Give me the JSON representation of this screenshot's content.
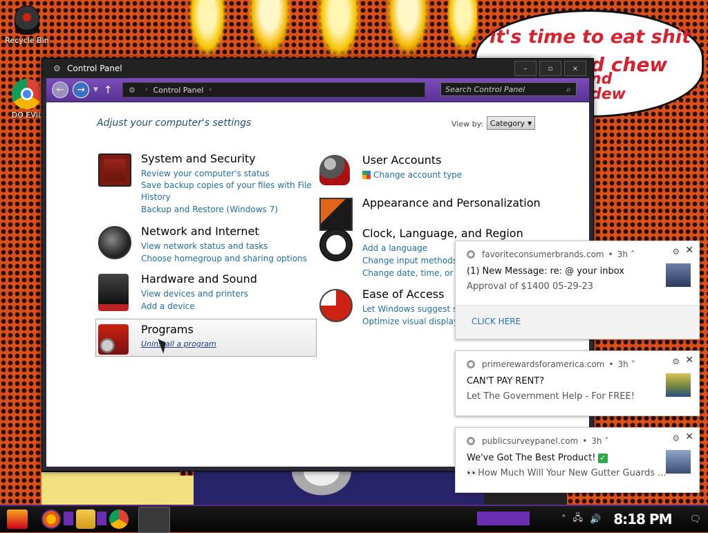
{
  "desktop": {
    "icons": [
      {
        "label": "Recycle Bin",
        "icon": "recycle-bin-icon"
      },
      {
        "label": "DO EVIL",
        "icon": "chrome-icon"
      }
    ],
    "wallpaper_text": [
      "it's time to eat shit",
      "d chew",
      "nd",
      "dew"
    ]
  },
  "window": {
    "title": "Control Panel",
    "buttons": {
      "minimize": "–",
      "maximize": "▫",
      "close": "×"
    },
    "address": {
      "crumb": "Control Panel"
    },
    "search": {
      "placeholder": "Search Control Panel"
    },
    "heading": "Adjust your computer's settings",
    "view_by": {
      "label": "View by:",
      "value": "Category"
    },
    "categories": [
      {
        "title": "System and Security",
        "icon": "system-security-icon",
        "links": [
          "Review your computer's status",
          "Save backup copies of your files with File History",
          "Backup and Restore (Windows 7)"
        ]
      },
      {
        "title": "Network and Internet",
        "icon": "network-icon",
        "links": [
          "View network status and tasks",
          "Choose homegroup and sharing options"
        ]
      },
      {
        "title": "Hardware and Sound",
        "icon": "hardware-icon",
        "links": [
          "View devices and printers",
          "Add a device"
        ]
      },
      {
        "title": "Programs",
        "icon": "programs-icon",
        "links": [
          "Uninstall a program"
        ]
      },
      {
        "title": "User Accounts",
        "icon": "user-accounts-icon",
        "links": [
          "Change account type"
        ]
      },
      {
        "title": "Appearance and Personalization",
        "icon": "appearance-icon",
        "links": []
      },
      {
        "title": "Clock, Language, and Region",
        "icon": "clock-icon",
        "links": [
          "Add a language",
          "Change input methods",
          "Change date, time, or num"
        ]
      },
      {
        "title": "Ease of Access",
        "icon": "ease-of-access-icon",
        "links": [
          "Let Windows suggest set",
          "Optimize visual display"
        ]
      }
    ]
  },
  "notifications": [
    {
      "source": "favoriteconsumerbrands.com",
      "age": "3h",
      "chevron": "˄",
      "line1": "(1) New Message: re: @ your inbox",
      "line2": "Approval of $1400 05-29-23",
      "action": "CLICK HERE"
    },
    {
      "source": "primerewardsforamerica.com",
      "age": "3h",
      "chevron": "˅",
      "line1": " CAN'T PAY RENT?",
      "line2": "Let The Government Help - For FREE!"
    },
    {
      "source": "publicsurveypanel.com",
      "age": "3h",
      "chevron": "˅",
      "line1": "We've Got The Best Product!",
      "line2": "👀How Much Will Your New Gutter Guards ..."
    }
  ],
  "taskbar": {
    "apps": [
      "firefox-icon",
      "file-explorer-icon",
      "chrome-icon",
      "control-panel-icon"
    ],
    "clock": "8:18 PM"
  },
  "colors": {
    "link": "#1e6fa8",
    "heading": "#1e4e79",
    "window_chrome": "#5a3197",
    "notification_action": "#1e6fd0"
  }
}
